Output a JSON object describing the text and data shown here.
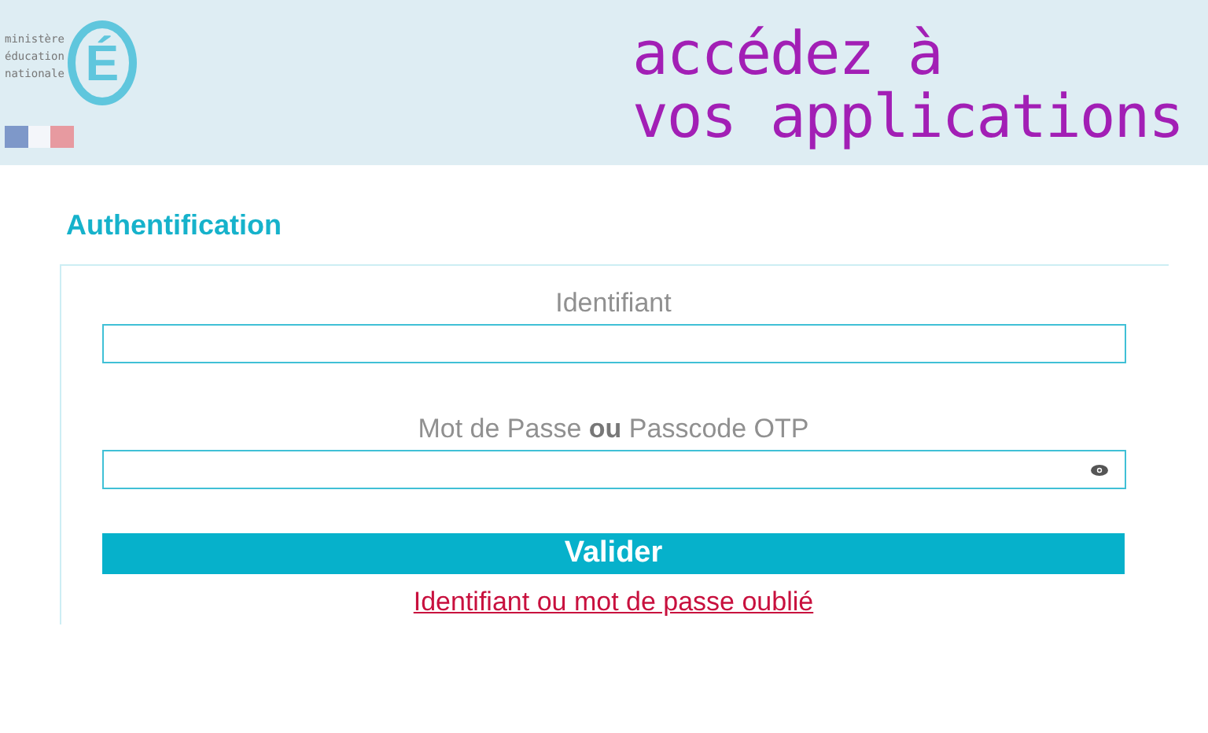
{
  "header": {
    "logo_lines": [
      "ministère",
      "éducation",
      "nationale"
    ],
    "logo_letter": "É",
    "tagline": [
      "accédez à",
      "vos applications"
    ]
  },
  "title": "Authentification",
  "form": {
    "fields": [
      {
        "kind": "text",
        "label_parts": [
          "Identifiant"
        ]
      },
      {
        "kind": "password",
        "label_parts": [
          "Mot de Passe",
          "ou",
          "Passcode OTP"
        ]
      }
    ],
    "submit": "Valider",
    "forgot_link": "Identifiant ou mot de passe oublié"
  }
}
